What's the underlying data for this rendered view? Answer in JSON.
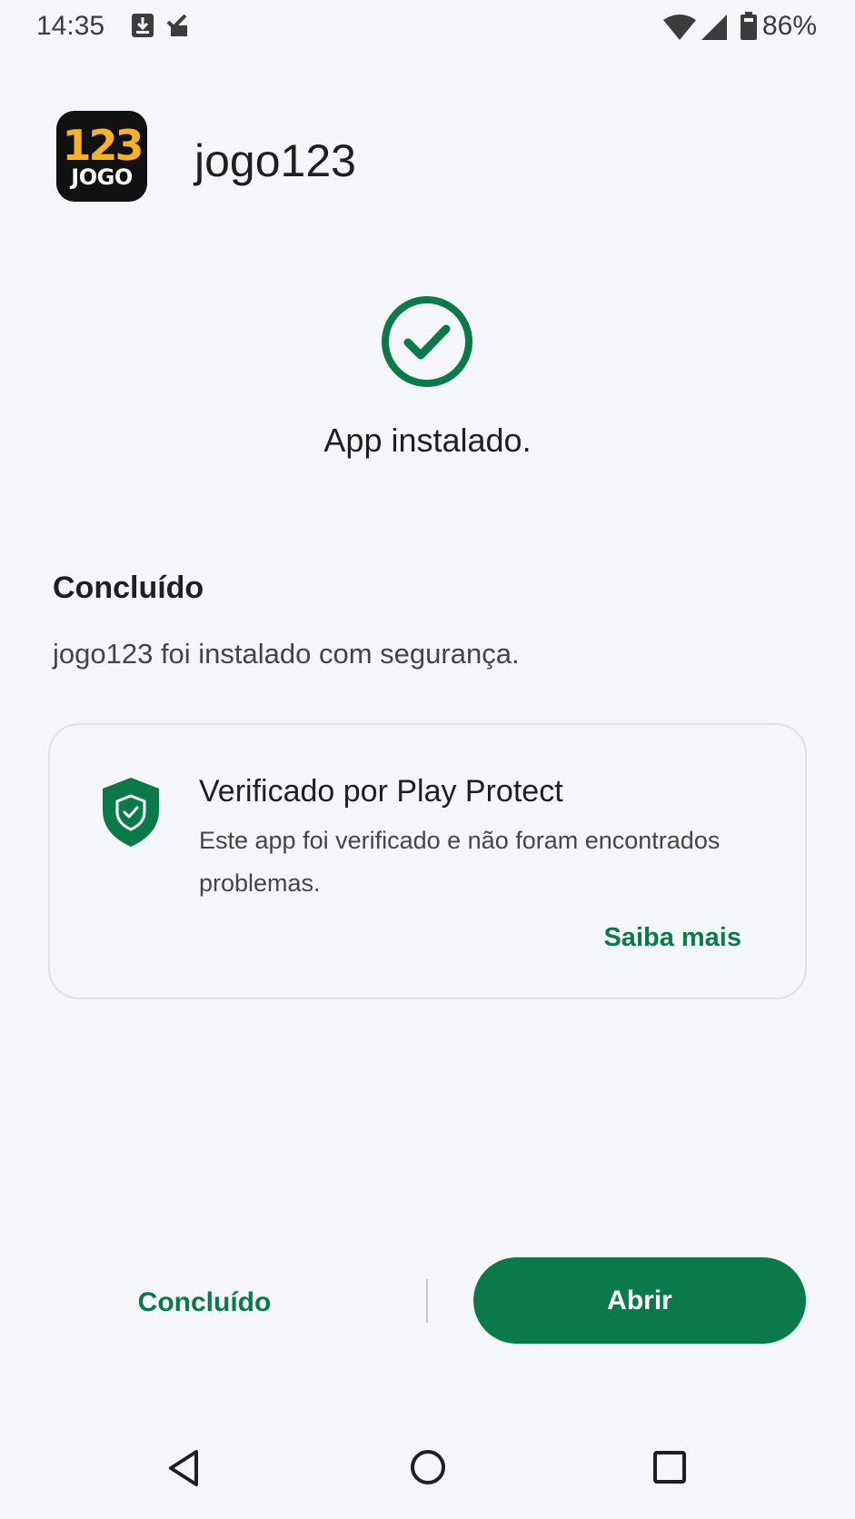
{
  "status_bar": {
    "time": "14:35",
    "left_icons": [
      "download-icon",
      "task-done-icon"
    ],
    "right_icons": [
      "wifi-icon",
      "cellular-signal-icon",
      "battery-icon"
    ],
    "battery_percent": "86%"
  },
  "app": {
    "icon_number": "123",
    "icon_word": "JOGO",
    "name": "jogo123"
  },
  "success": {
    "icon": "check-circle-icon",
    "message": "App instalado."
  },
  "section": {
    "title": "Concluído",
    "description": "jogo123 foi instalado com segurança."
  },
  "protect_card": {
    "icon": "shield-check-icon",
    "title": "Verificado por Play Protect",
    "description": "Este app foi verificado e não foram encontrados problemas.",
    "link_label": "Saiba mais"
  },
  "actions": {
    "done_label": "Concluído",
    "open_label": "Abrir"
  },
  "nav_bar": {
    "items": [
      "back-icon",
      "home-icon",
      "recents-icon"
    ]
  },
  "colors": {
    "background": "#f5f6f9",
    "accent_green": "#0b7a4b",
    "app_icon_number": "#f6b323"
  }
}
